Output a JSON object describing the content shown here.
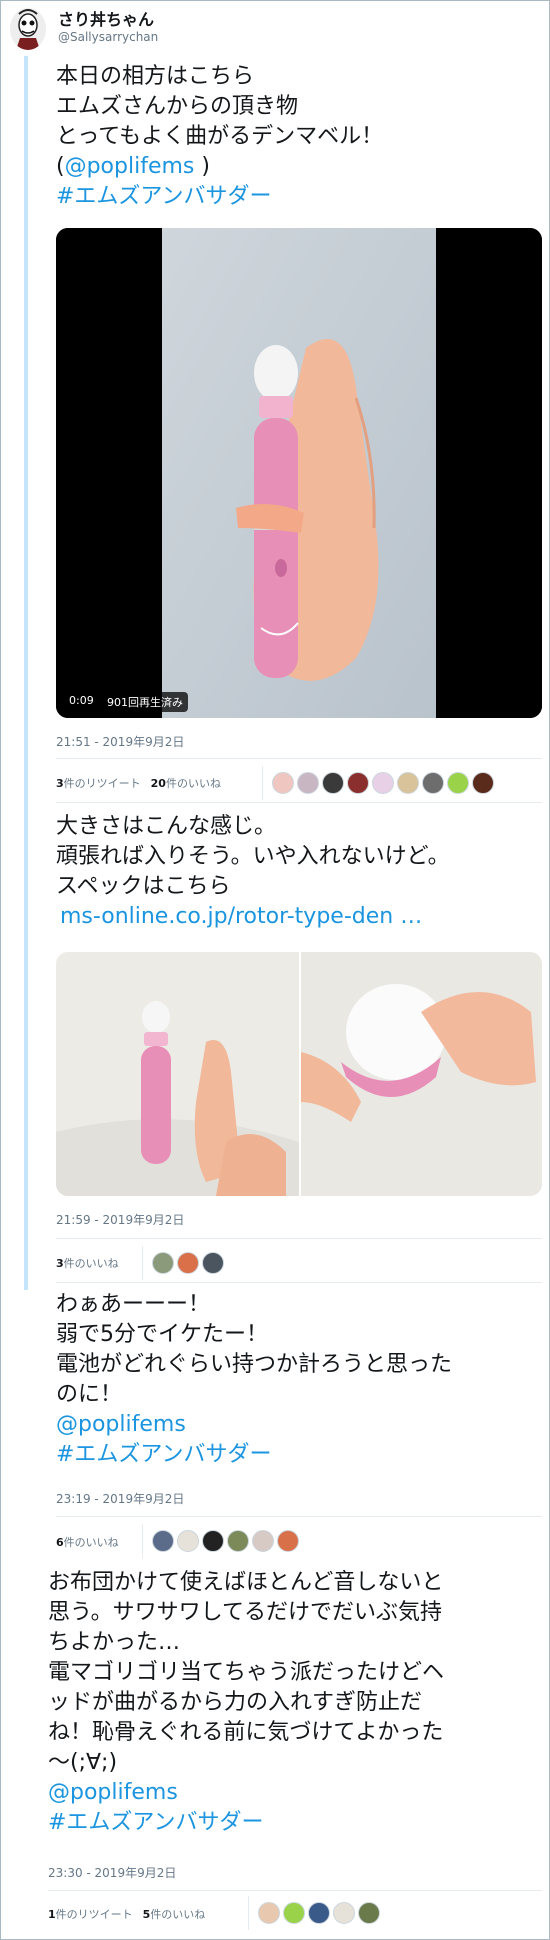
{
  "author": {
    "name": "さり丼ちゃん",
    "handle": "@Sallysarrychan"
  },
  "tweet1": {
    "lines": [
      "本日の相方はこちら",
      "エムズさんからの頂き物",
      "とってもよく曲がるデンマベル！"
    ],
    "mention_prefix": "(",
    "mention": "@poplifems",
    "mention_suffix": " )",
    "hashtag": "#エムズアンバサダー",
    "video_duration": "0:09",
    "video_views": "901回再生済み",
    "timestamp": "21:51 - 2019年9月2日",
    "retweets_count": "3",
    "retweets_label": "件のリツイート",
    "likes_count": "20",
    "likes_label": "件のいいね"
  },
  "tweet2": {
    "lines": [
      "大きさはこんな感じ。",
      "頑張れば入りそう。いや入れないけど。",
      "スペックはこちら"
    ],
    "link": "ms-online.co.jp/rotor-type-den …",
    "timestamp": "21:59 - 2019年9月2日",
    "likes_count": "3",
    "likes_label": "件のいいね"
  },
  "tweet3": {
    "lines": [
      "わぁあーーー！",
      "弱で5分でイケたー！",
      "電池がどれぐらい持つか計ろうと思った",
      "のに！"
    ],
    "mention": "@poplifems",
    "hashtag": "#エムズアンバサダー",
    "timestamp": "23:19 - 2019年9月2日",
    "likes_count": "6",
    "likes_label": "件のいいね"
  },
  "tweet4": {
    "lines": [
      "お布団かけて使えばほとんど音しないと",
      "思う。サワサワしてるだけでだいぶ気持",
      "ちよかった…",
      "電マゴリゴリ当てちゃう派だったけどヘ",
      "ッドが曲がるから力の入れすぎ防止だ",
      "ね！恥骨えぐれる前に気づけてよかった",
      "〜(;∀;)"
    ],
    "mention": "@poplifems",
    "hashtag": "#エムズアンバサダー",
    "timestamp": "23:30 - 2019年9月2日",
    "retweets_count": "1",
    "retweets_label": "件のリツイート",
    "likes_count": "5",
    "likes_label": "件のいいね"
  },
  "colors": {
    "link": "#1b95e0",
    "thread_line": "#c4e5fb",
    "muted": "#657786",
    "product_pink": "#e88fb8"
  }
}
